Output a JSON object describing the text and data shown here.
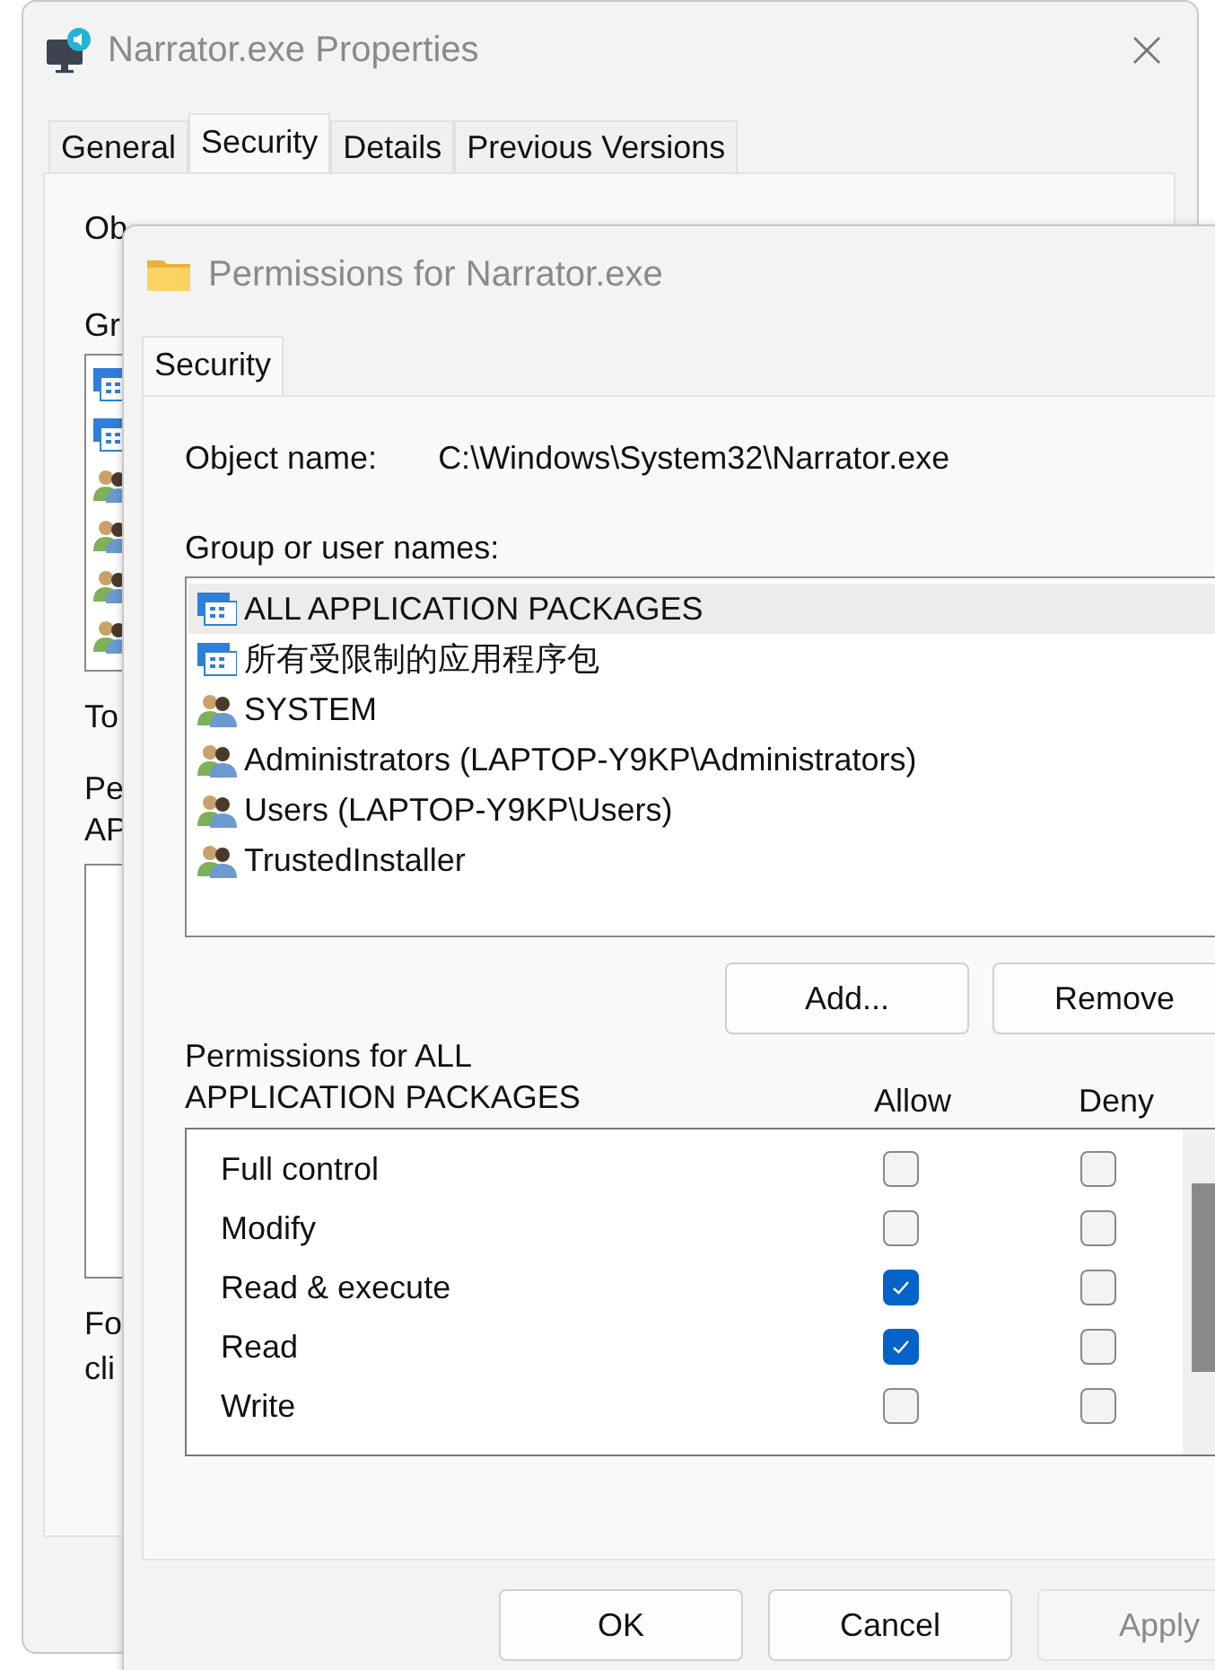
{
  "back_window": {
    "title": "Narrator.exe Properties",
    "tabs": [
      {
        "label": "General",
        "selected": false
      },
      {
        "label": "Security",
        "selected": true
      },
      {
        "label": "Details",
        "selected": false
      },
      {
        "label": "Previous Versions",
        "selected": false
      }
    ],
    "object_label": "Ob",
    "group_label": "Gr",
    "group_icons": [
      {
        "kind": "package"
      },
      {
        "kind": "package"
      },
      {
        "kind": "user"
      },
      {
        "kind": "user"
      },
      {
        "kind": "user"
      },
      {
        "kind": "user"
      }
    ],
    "edit_label": "To",
    "permissions_label": [
      "Pe",
      "AP"
    ],
    "footer_text": [
      "Fo",
      "cli"
    ]
  },
  "front_window": {
    "title": "Permissions for Narrator.exe",
    "tabs": [
      {
        "label": "Security",
        "selected": true
      }
    ],
    "object_name_label": "Object name:",
    "object_name_value": "C:\\Windows\\System32\\Narrator.exe",
    "group_label": "Group or user names:",
    "groups": [
      {
        "name": "ALL APPLICATION PACKAGES",
        "kind": "package",
        "selected": true
      },
      {
        "name": "所有受限制的应用程序包",
        "kind": "package",
        "selected": false
      },
      {
        "name": "SYSTEM",
        "kind": "user",
        "selected": false
      },
      {
        "name": "Administrators (LAPTOP-Y9KP\\Administrators)",
        "kind": "user",
        "selected": false
      },
      {
        "name": "Users (LAPTOP-Y9KP\\Users)",
        "kind": "user",
        "selected": false
      },
      {
        "name": "TrustedInstaller",
        "kind": "user",
        "selected": false
      }
    ],
    "group_buttons": [
      "Add...",
      "Remove"
    ],
    "permissions_label": [
      "Permissions for ALL",
      "APPLICATION PACKAGES"
    ],
    "columns": [
      "Allow",
      "Deny"
    ],
    "permissions": [
      {
        "name": "Full control",
        "allow": false,
        "deny": false
      },
      {
        "name": "Modify",
        "allow": false,
        "deny": false
      },
      {
        "name": "Read & execute",
        "allow": true,
        "deny": false
      },
      {
        "name": "Read",
        "allow": true,
        "deny": false
      },
      {
        "name": "Write",
        "allow": false,
        "deny": false
      }
    ],
    "buttons": [
      {
        "label": "OK",
        "disabled": false
      },
      {
        "label": "Cancel",
        "disabled": false
      },
      {
        "label": "Apply",
        "disabled": true
      }
    ]
  }
}
